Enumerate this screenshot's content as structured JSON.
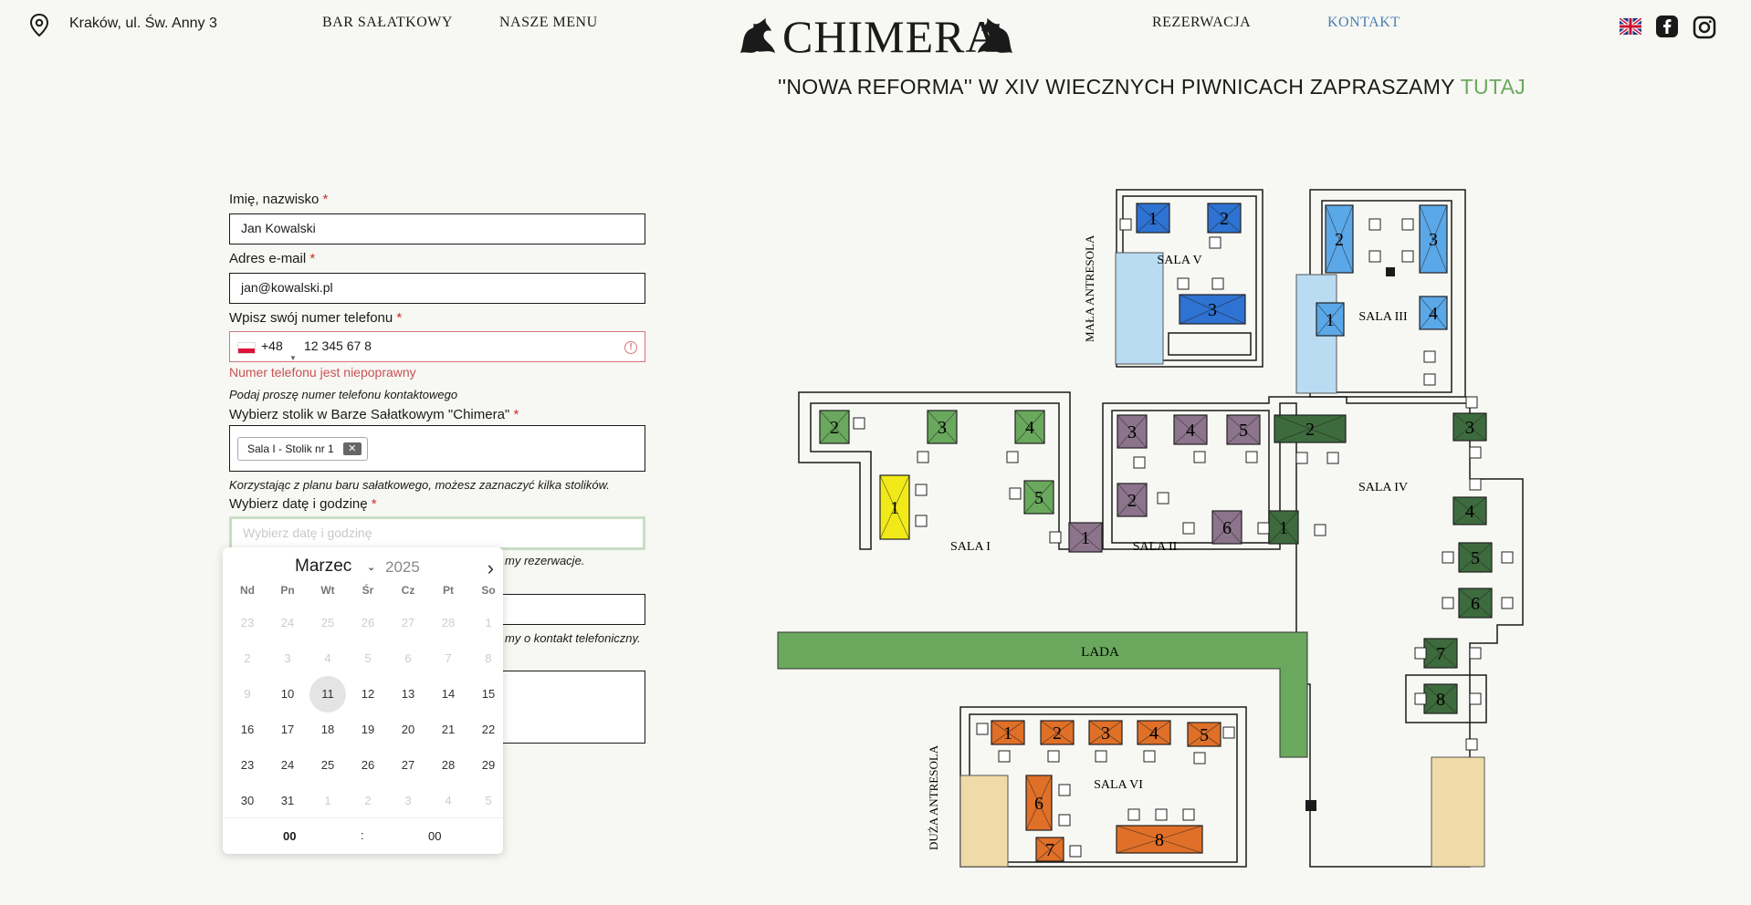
{
  "header": {
    "address": "Kraków, ul. Św. Anny 3",
    "nav_left": [
      "BAR SAŁATKOWY",
      "NASZE MENU"
    ],
    "logo": "CHIMERA",
    "nav_right": [
      "REZERWACJA",
      "KONTAKT"
    ]
  },
  "promo": {
    "text": "''NOWA REFORMA'' W XIV WIECZNYCH PIWNICACH ZAPRASZAMY",
    "link": "TUTAJ"
  },
  "form": {
    "name_label": "Imię, nazwisko",
    "name_value": "Jan Kowalski",
    "email_label": "Adres e-mail",
    "email_value": "jan@kowalski.pl",
    "phone_label": "Wpisz swój numer telefonu",
    "phone_code": "+48",
    "phone_value": "12 345 67 8",
    "phone_error": "Numer telefonu jest niepoprawny",
    "phone_hint": "Podaj proszę numer telefonu kontaktowego",
    "table_label": "Wybierz stolik w Barze Sałatkowym \"Chimera\"",
    "table_tag": "Sala I - Stolik nr 1",
    "table_hint": "Korzystając z planu baru sałatkowego, możesz zaznaczyć kilka stolików.",
    "date_label": "Wybierz datę i godzinę",
    "date_placeholder": "Wybierz datę i godzinę",
    "hint_after_date": "my rezerwacje.",
    "hint_after_phone": "my o kontakt telefoniczny.",
    "required_mark": "*"
  },
  "datepicker": {
    "month": "Marzec",
    "year": "2025",
    "weekdays": [
      "Nd",
      "Pn",
      "Wt",
      "Śr",
      "Cz",
      "Pt",
      "So"
    ],
    "weeks": [
      [
        "23",
        "24",
        "25",
        "26",
        "27",
        "28",
        "1"
      ],
      [
        "2",
        "3",
        "4",
        "5",
        "6",
        "7",
        "8"
      ],
      [
        "9",
        "10",
        "11",
        "12",
        "13",
        "14",
        "15"
      ],
      [
        "16",
        "17",
        "18",
        "19",
        "20",
        "21",
        "22"
      ],
      [
        "23",
        "24",
        "25",
        "26",
        "27",
        "28",
        "29"
      ],
      [
        "30",
        "31",
        "1",
        "2",
        "3",
        "4",
        "5"
      ]
    ],
    "today": "11",
    "hour": "00",
    "minute": "00"
  },
  "map": {
    "rooms": [
      "SALA I",
      "SALA II",
      "SALA III",
      "SALA IV",
      "SALA V",
      "SALA VI"
    ],
    "counter": "LADA",
    "mezzanine_small": "MAŁA ANTRESOLA",
    "mezzanine_large": "DUŻA ANTRESOLA",
    "colors": {
      "sala1": "#f2ea18",
      "sala1_green": "#6aa95d",
      "sala2": "#8c748c",
      "sala3": "#5ba8e8",
      "sala4": "#3d6b3d",
      "sala5": "#2e72d2",
      "sala6": "#e07028",
      "lada": "#6aa95d"
    }
  }
}
